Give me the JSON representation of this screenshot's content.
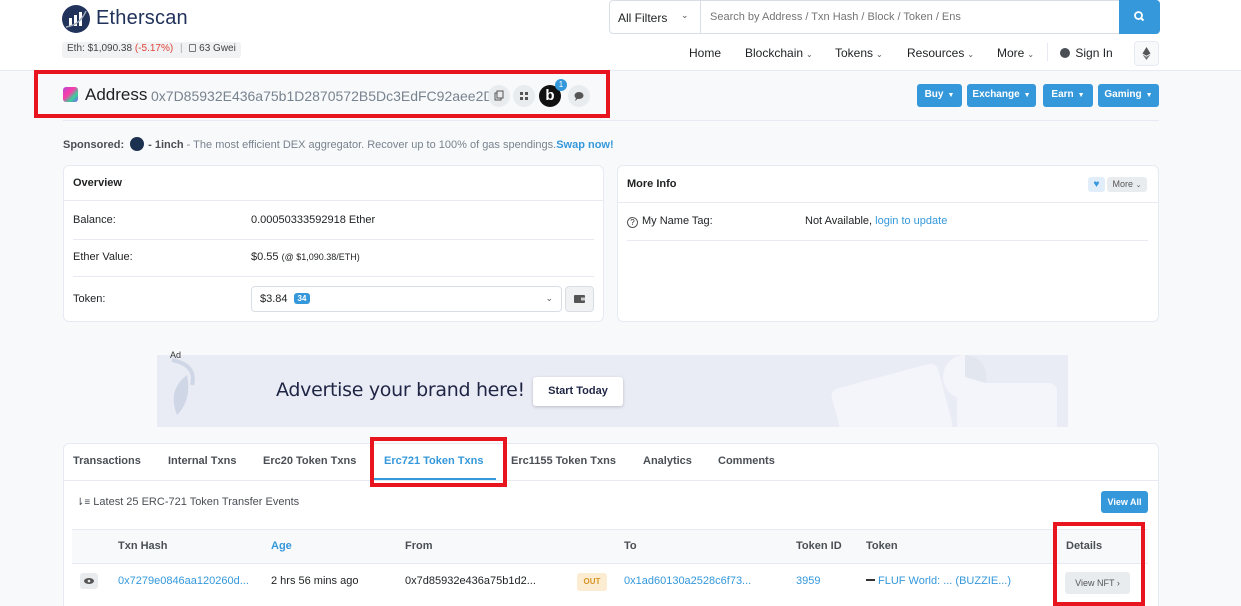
{
  "header": {
    "logo_text": "Etherscan",
    "eth_price_label": "Eth: $1,090.38",
    "eth_price_change": "(-5.17%)",
    "separator": "|",
    "gas": "63 Gwei",
    "filter_label": "All Filters",
    "search_placeholder": "Search by Address / Txn Hash / Block / Token / Ens",
    "nav": {
      "home": "Home",
      "blockchain": "Blockchain",
      "tokens": "Tokens",
      "resources": "Resources",
      "more": "More",
      "sign_in": "Sign In"
    }
  },
  "address": {
    "title": "Address",
    "hash": "0x7D85932E436a75b1D2870572B5Dc3EdFC92aee2D",
    "bsc_letter": "b",
    "bsc_badge": "1"
  },
  "actions": {
    "buy": "Buy",
    "exchange": "Exchange",
    "earn": "Earn",
    "gaming": "Gaming"
  },
  "sponsored": {
    "label": "Sponsored:",
    "dash": "-",
    "name": "1inch",
    "text": "- The most efficient DEX aggregator. Recover up to 100% of gas spendings.",
    "cta": "Swap now!"
  },
  "overview": {
    "title": "Overview",
    "balance_label": "Balance:",
    "balance_value": "0.00050333592918 Ether",
    "ether_value_label": "Ether Value:",
    "ether_value": "$0.55",
    "ether_rate": "(@ $1,090.38/ETH)",
    "token_label": "Token:",
    "token_value": "$3.84",
    "token_count": "34"
  },
  "more_info": {
    "title": "More Info",
    "more_button": "More",
    "name_tag_label": "My Name Tag:",
    "name_tag_value": "Not Available,",
    "name_tag_link": "login to update"
  },
  "ad": {
    "tag": "Ad",
    "headline": "Advertise your brand here!",
    "cta": "Start Today"
  },
  "tabs": [
    "Transactions",
    "Internal Txns",
    "Erc20 Token Txns",
    "Erc721 Token Txns",
    "Erc1155 Token Txns",
    "Analytics",
    "Comments"
  ],
  "table": {
    "summary": "Latest 25 ERC-721 Token Transfer Events",
    "view_all": "View All",
    "headers": [
      "Txn Hash",
      "Age",
      "From",
      "To",
      "Token ID",
      "Token",
      "Details"
    ],
    "rows": [
      {
        "txn_hash": "0x7279e0846aa120260d...",
        "age": "2 hrs 56 mins ago",
        "from": "0x7d85932e436a75b1d2...",
        "direction": "OUT",
        "to": "0x1ad60130a2528c6f73...",
        "token_id": "3959",
        "token": "FLUF World: ... (BUZZIE...)",
        "details": "View NFT"
      }
    ]
  },
  "colors": {
    "accent": "#3498db",
    "highlight": "#e8141e",
    "negative": "#de4437"
  }
}
